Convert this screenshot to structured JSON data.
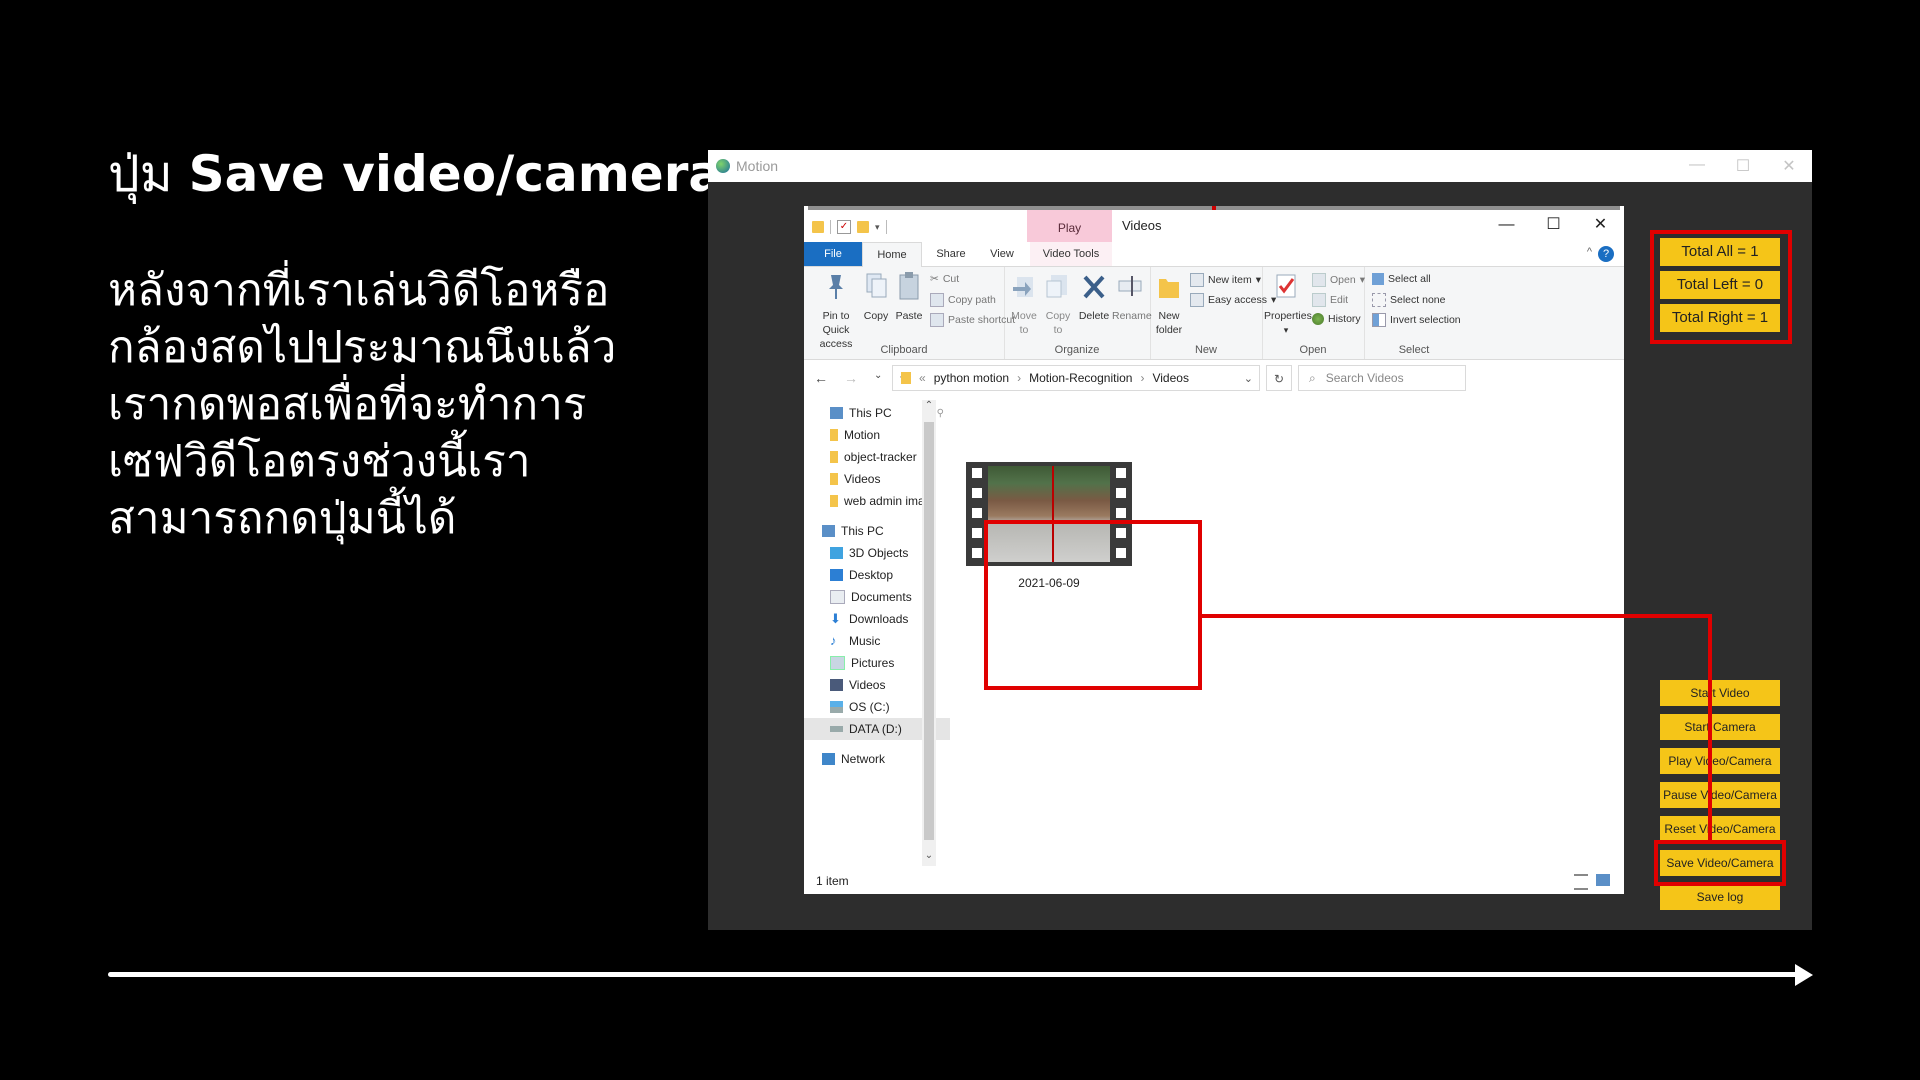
{
  "slide": {
    "title_prefix": "ปุ่ม",
    "title_bold": "Save video/camera",
    "body_lines": [
      "หลังจากที่เราเล่นวิดีโอหรือ",
      "กล้องสดไปประมาณนึงแล้ว",
      "เรากดพอสเพื่อที่จะทำการ",
      "เซฟวิดีโอตรงช่วงนี้เรา",
      "สามารถกดปุ่มนี้ได้"
    ]
  },
  "motion_window": {
    "title": "Motion",
    "controls": [
      "—",
      "☐",
      "✕"
    ]
  },
  "explorer": {
    "contextual_tab": "Play",
    "title": "Videos",
    "controls": [
      "—",
      "☐",
      "✕"
    ],
    "tabs": [
      "File",
      "Home",
      "Share",
      "View",
      "Video Tools"
    ],
    "ribbon": {
      "clipboard": {
        "label": "Clipboard",
        "pin": "Pin to Quick access",
        "copy": "Copy",
        "paste": "Paste",
        "cut": "Cut",
        "copy_path": "Copy path",
        "paste_shortcut": "Paste shortcut"
      },
      "organize": {
        "label": "Organize",
        "move_to": "Move to",
        "copy_to": "Copy to",
        "delete": "Delete",
        "rename": "Rename"
      },
      "new": {
        "label": "New",
        "new_folder": "New folder",
        "new_item": "New item",
        "easy_access": "Easy access"
      },
      "open": {
        "label": "Open",
        "properties": "Properties",
        "open": "Open",
        "edit": "Edit",
        "history": "History"
      },
      "select": {
        "label": "Select",
        "select_all": "Select all",
        "select_none": "Select none",
        "invert": "Invert selection"
      }
    },
    "address": {
      "chevron": "«",
      "crumbs": [
        "python motion",
        "Motion-Recognition",
        "Videos"
      ]
    },
    "search_placeholder": "Search Videos",
    "nav_items": [
      {
        "label": "This PC",
        "icon": "pc-icon"
      },
      {
        "label": "Motion",
        "icon": "folder-icon"
      },
      {
        "label": "object-tracker",
        "icon": "folder-icon"
      },
      {
        "label": "Videos",
        "icon": "folder-icon"
      },
      {
        "label": "web admin imag",
        "icon": "folder-icon"
      },
      {
        "label": "This PC",
        "icon": "pc-icon"
      },
      {
        "label": "3D Objects",
        "icon": "cube-icon"
      },
      {
        "label": "Desktop",
        "icon": "desktop-icon"
      },
      {
        "label": "Documents",
        "icon": "document-icon"
      },
      {
        "label": "Downloads",
        "icon": "download-icon"
      },
      {
        "label": "Music",
        "icon": "music-icon"
      },
      {
        "label": "Pictures",
        "icon": "pictures-icon"
      },
      {
        "label": "Videos",
        "icon": "video-icon"
      },
      {
        "label": "OS (C:)",
        "icon": "drive-icon"
      },
      {
        "label": "DATA (D:)",
        "icon": "drive-icon"
      },
      {
        "label": "Network",
        "icon": "network-icon"
      }
    ],
    "file_item": {
      "name": "2021-06-09"
    },
    "status": "1 item"
  },
  "stats": {
    "total_all": "Total All = 1",
    "total_left": "Total Left = 0",
    "total_right": "Total Right = 1"
  },
  "buttons": {
    "start_video": "Start Video",
    "start_camera": "Start Camera",
    "play": "Play Video/Camera",
    "pause": "Pause Video/Camera",
    "reset": "Reset Video/Camera",
    "save": "Save Video/Camera",
    "save_log": "Save log"
  },
  "colors": {
    "background": "#000000",
    "accent_yellow": "#f5c518",
    "highlight_red": "#e00000",
    "explorer_blue": "#1a6ec2"
  }
}
